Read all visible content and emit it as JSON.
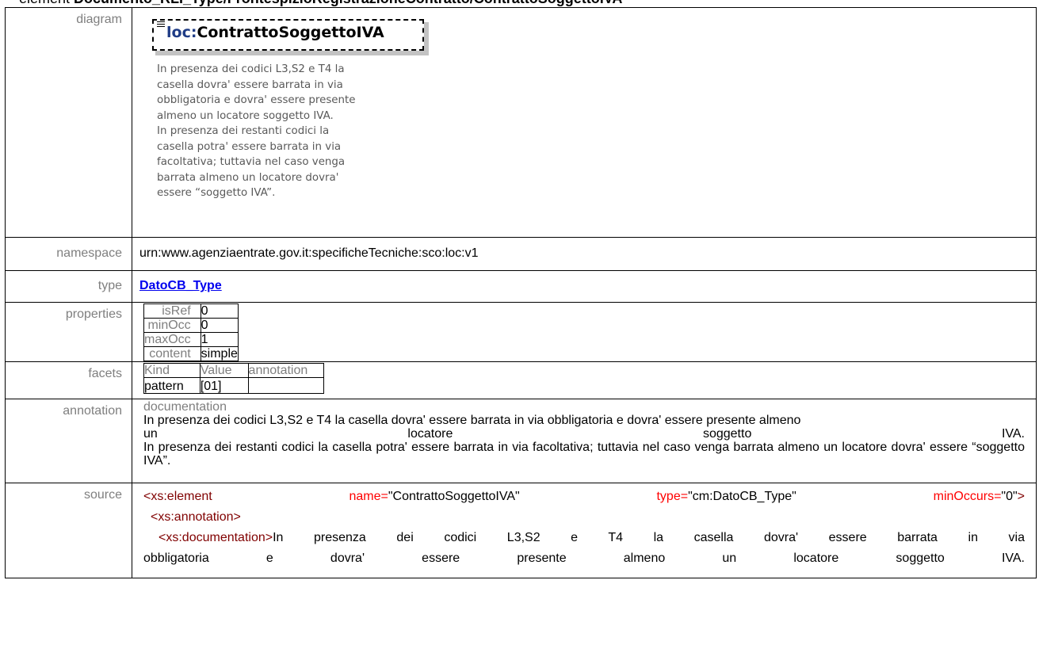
{
  "header": {
    "prefix": "element",
    "path": " Documento_RLI_Type/FrontespizioRegistrazioneContratto/ContrattoSoggettoIVA"
  },
  "rows": {
    "diagram": {
      "label": "diagram"
    },
    "namespace": {
      "label": "namespace",
      "value": "urn:www.agenziaentrate.gov.it:specificheTecniche:sco:loc:v1"
    },
    "type": {
      "label": "type",
      "value": "DatoCB_Type"
    },
    "properties": {
      "label": "properties"
    },
    "facets": {
      "label": "facets"
    },
    "annotation": {
      "label": "annotation"
    },
    "source": {
      "label": "source"
    }
  },
  "diagram": {
    "namespace_prefix": "loc:",
    "element_name": "ContrattoSoggettoIVA",
    "note_lines": [
      "In presenza dei codici L3,S2 e T4 la",
      "casella dovra' essere barrata in via",
      "obbligatoria e dovra' essere presente",
      "almeno un locatore soggetto IVA.",
      "In presenza dei restanti codici la",
      "casella potra' essere barrata in via",
      "facoltativa; tuttavia nel caso venga",
      "barrata almeno un locatore dovra'",
      "essere “soggetto IVA”."
    ]
  },
  "properties": [
    {
      "key": "isRef",
      "value": "0"
    },
    {
      "key": "minOcc",
      "value": "0"
    },
    {
      "key": "maxOcc",
      "value": "1"
    },
    {
      "key": "content",
      "value": "simple"
    }
  ],
  "facets": {
    "headers": [
      "Kind",
      "Value",
      "annotation"
    ],
    "rows": [
      {
        "kind": "pattern",
        "value": "[01]",
        "annotation": ""
      }
    ]
  },
  "annotation": {
    "heading": "documentation",
    "line1": "In presenza dei codici L3,S2 e T4 la casella dovra' essere barrata in via obbligatoria e dovra' essere presente almeno",
    "line2": "un locatore soggetto IVA.",
    "line3": "In presenza dei restanti codici la casella potra' essere barrata in via facoltativa; tuttavia nel caso venga barrata almeno un locatore dovra' essere “soggetto IVA”."
  },
  "source": {
    "tag_element": "<xs:element",
    "attr_name": "name",
    "val_name": "\"ContrattoSoggettoIVA\"",
    "attr_type": "type",
    "val_type": "\"cm:DatoCB_Type\"",
    "attr_min": "minOccurs",
    "val_min": "\"0\"",
    "tag_close": ">",
    "equals": "=",
    "tag_annotation": "<xs:annotation>",
    "tag_documentation": "<xs:documentation>",
    "doc_line1": "In presenza dei codici L3,S2 e T4 la casella dovra' essere barrata in via",
    "doc_line2": "obbligatoria e dovra' essere presente almeno un locatore soggetto IVA."
  }
}
